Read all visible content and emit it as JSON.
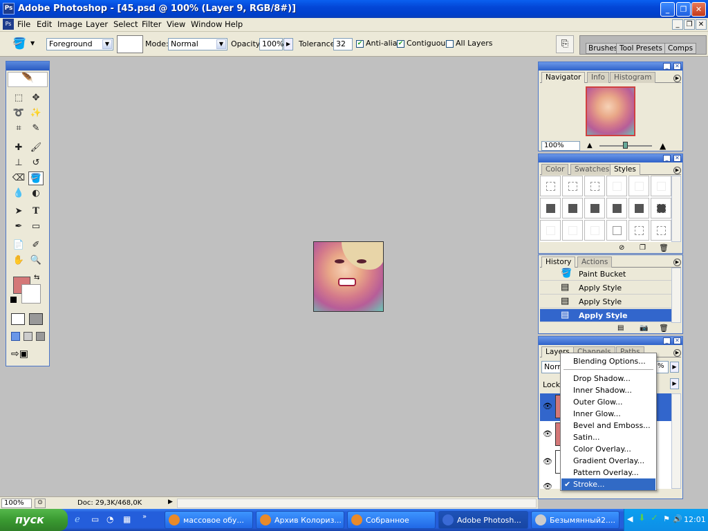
{
  "window": {
    "title": "Adobe Photoshop - [45.psd @ 100% (Layer 9, RGB/8#)]",
    "app_icon": "Ps"
  },
  "menu": [
    "File",
    "Edit",
    "Image",
    "Layer",
    "Select",
    "Filter",
    "View",
    "Window",
    "Help"
  ],
  "options": {
    "fill_source": "Foreground",
    "mode_label": "Mode:",
    "mode_value": "Normal",
    "opacity_label": "Opacity:",
    "opacity_value": "100%",
    "tolerance_label": "Tolerance:",
    "tolerance_value": "32",
    "anti_alias": "Anti-alias",
    "contiguous": "Contiguous",
    "all_layers": "All Layers",
    "well_tabs": [
      "Brushes",
      "Tool Presets",
      "Comps"
    ]
  },
  "navigator": {
    "tabs": [
      "Navigator",
      "Info",
      "Histogram"
    ],
    "zoom": "100%"
  },
  "styles_panel": {
    "tabs": [
      "Color",
      "Swatches",
      "Styles"
    ]
  },
  "history": {
    "tabs": [
      "History",
      "Actions"
    ],
    "items": [
      {
        "label": "Paint Bucket",
        "icon": "paint-bucket"
      },
      {
        "label": "Apply Style",
        "icon": "document"
      },
      {
        "label": "Apply Style",
        "icon": "document"
      },
      {
        "label": "Apply Style",
        "icon": "document"
      }
    ]
  },
  "layers": {
    "tabs": [
      "Layers",
      "Channels",
      "Paths"
    ],
    "blend": "Norm",
    "opacity": "%",
    "lock_label": "Lock:"
  },
  "context_menu": {
    "items": [
      "Blending Options...",
      "Drop Shadow...",
      "Inner Shadow...",
      "Outer Glow...",
      "Inner Glow...",
      "Bevel and Emboss...",
      "Satin...",
      "Color Overlay...",
      "Gradient Overlay...",
      "Pattern Overlay...",
      "Stroke..."
    ],
    "checked": "Stroke..."
  },
  "status": {
    "zoom": "100%",
    "doc": "Doc: 29,3K/468,0K"
  },
  "taskbar": {
    "start": "пуск",
    "tasks": [
      "массовое обу...",
      "Архив Колориз...",
      "Собранное",
      "Adobe Photosh...",
      "Безымянный2...."
    ],
    "active": "Adobe Photosh...",
    "clock": "12:01"
  },
  "colors": {
    "foreground": "#d47878",
    "background": "#ffffff",
    "accent": "#316ac5"
  }
}
